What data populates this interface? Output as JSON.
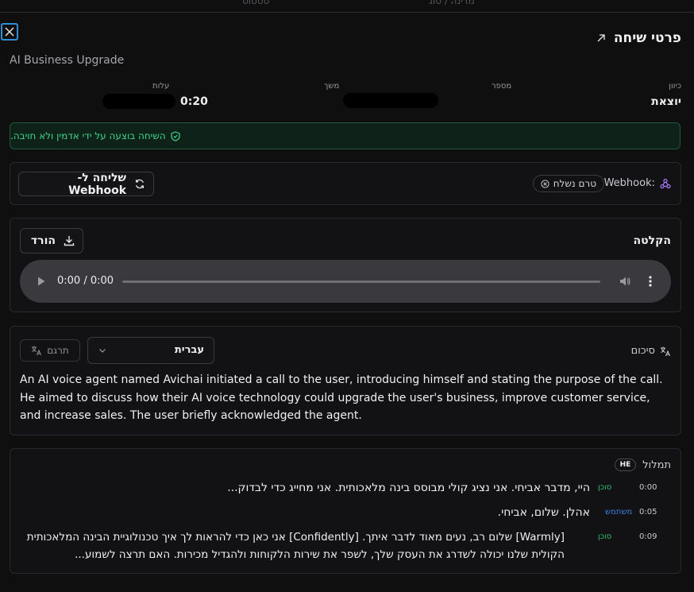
{
  "topbar": {
    "col_status": "סטטוס",
    "col_country": "מדינה / סוג"
  },
  "header": {
    "title": "פרטי שיחה",
    "subtitle": "AI Business Upgrade"
  },
  "meta": {
    "direction_label": "כיוון",
    "direction_value": "יוצאת",
    "number_label": "מספר",
    "duration_label": "משך",
    "cost_label": "עלות",
    "duration_value": "0:20"
  },
  "alert": {
    "text": "השיחה בוצעה על ידי אדמין ולא חויבה."
  },
  "webhook": {
    "label": "Webhook:",
    "status": "טרם נשלח",
    "send_button": "שליחה ל-Webhook"
  },
  "recording": {
    "title": "הקלטה",
    "download_button": "הורד",
    "time": "0:00 / 0:00"
  },
  "summary": {
    "label": "סיכום",
    "language": "עברית",
    "translate_button": "תרגם",
    "text": "An AI voice agent named Avichai initiated a call to the user, introducing himself and stating the purpose of the call. He aimed to discuss how their AI voice technology could upgrade the user's business, improve customer service, and increase sales. The user briefly acknowledged the agent."
  },
  "transcript": {
    "label": "תמלול",
    "lang_badge": "HE",
    "entries": [
      {
        "time": "0:00",
        "speaker": "סוכן",
        "text": "היי, מדבר אביחי. אני נציג קולי מבוסס בינה מלאכותית. אני מחייג כדי לבדוק..."
      },
      {
        "time": "0:05",
        "speaker": "משתמש",
        "text": "אהלן. שלום, אביחי."
      },
      {
        "time": "0:09",
        "speaker": "סוכן",
        "text": "[Warmly] שלום רב, נעים מאוד לדבר איתך. [Confidently] אני כאן כדי להראות לך איך טכנולוגיית הבינה המלאכותית הקולית שלנו יכולה לשדרג את העסק שלך, לשפר את שירות הלקוחות ולהגדיל מכירות. האם תרצה לשמוע..."
      }
    ]
  },
  "colors": {
    "agent": "#2fbf71",
    "user": "#3b7fe0",
    "alert_green": "#3fd58c",
    "focus_blue": "#2f8fd6"
  }
}
